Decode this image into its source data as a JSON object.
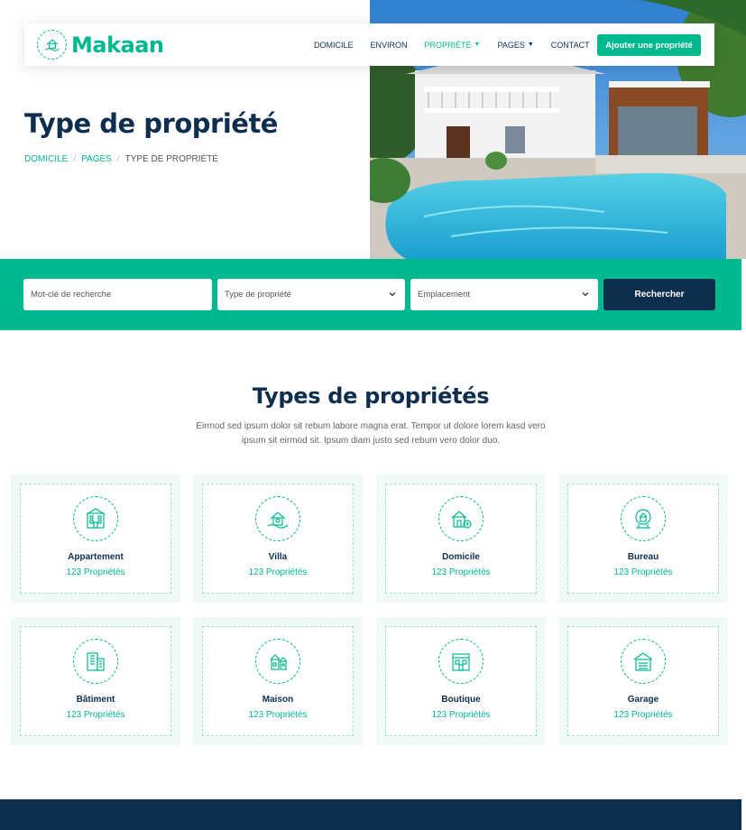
{
  "brand": {
    "name": "Makaan",
    "icon": "home-hand-icon"
  },
  "nav": {
    "items": [
      {
        "label": "Domicile",
        "active": false,
        "dropdown": false
      },
      {
        "label": "Environ",
        "active": false,
        "dropdown": false
      },
      {
        "label": "Propriété",
        "active": true,
        "dropdown": true
      },
      {
        "label": "Pages",
        "active": false,
        "dropdown": true
      },
      {
        "label": "Contact",
        "active": false,
        "dropdown": false
      }
    ],
    "cta_label": "Ajouter une propriété"
  },
  "hero": {
    "title": "Type de propriété",
    "breadcrumb": [
      "Domicile",
      "Pages",
      "Type de propriété"
    ],
    "image": "house-with-pool-photo"
  },
  "search": {
    "keyword_placeholder": "Mot-clé de recherche",
    "type_selected": "Type de propriété",
    "location_selected": "Emplacement",
    "button_label": "Rechercher"
  },
  "section": {
    "title": "Types de propriétés",
    "description": "Eirmod sed ipsum dolor sit rebum labore magna erat. Tempor ut dolore lorem kasd vero ipsum sit eirmod sit. Ipsum diam justo sed rebum vero dolor duo."
  },
  "property_types": [
    {
      "name": "Appartement",
      "count": "123 Propriétés",
      "icon": "apartment-icon"
    },
    {
      "name": "Villa",
      "count": "123 Propriétés",
      "icon": "villa-icon"
    },
    {
      "name": "Domicile",
      "count": "123 Propriétés",
      "icon": "house-icon"
    },
    {
      "name": "Bureau",
      "count": "123 Propriétés",
      "icon": "office-icon"
    },
    {
      "name": "Bâtiment",
      "count": "123 Propriétés",
      "icon": "building-icon"
    },
    {
      "name": "Maison",
      "count": "123 Propriétés",
      "icon": "townhouse-icon"
    },
    {
      "name": "Boutique",
      "count": "123 Propriétés",
      "icon": "shop-icon"
    },
    {
      "name": "Garage",
      "count": "123 Propriétés",
      "icon": "garage-icon"
    }
  ],
  "colors": {
    "primary": "#00b98e",
    "dark": "#0e2e50",
    "light": "#eff9f5"
  }
}
